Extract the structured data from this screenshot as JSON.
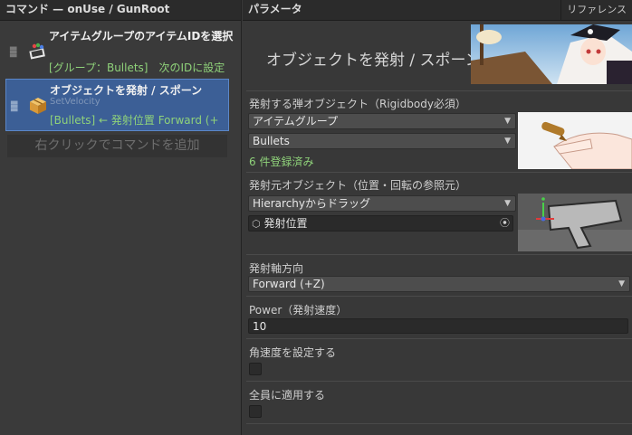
{
  "left": {
    "header": "コマンド — onUse / GunRoot",
    "commands": [
      {
        "title": "アイテムグループのアイテムIDを選択",
        "subtitle": "",
        "detail": "[グループ：Bullets]　次のIDに設定"
      },
      {
        "title": "オブジェクトを発射 / スポーン",
        "subtitle": "SetVelocity",
        "detail": "[Bullets] ← 発射位置  Forward (+"
      }
    ],
    "add_command": "右クリックでコマンドを追加"
  },
  "right": {
    "header": "パラメータ",
    "reference": "リファレンス",
    "title": "オブジェクトを発射 / スポーン",
    "projectile": {
      "label": "発射する弾オブジェクト（Rigidbody必須）",
      "source_select": "アイテムグループ",
      "group_select": "Bullets",
      "registered": "6 件登録済み"
    },
    "origin": {
      "label": "発射元オブジェクト（位置・回転の参照元）",
      "mode_select": "Hierarchyからドラッグ",
      "object_field": "発射位置"
    },
    "axis": {
      "label": "発射軸方向",
      "select": "Forward (+Z)"
    },
    "power": {
      "label": "Power（発射速度）",
      "value": "10"
    },
    "angular": {
      "label": "角速度を設定する"
    },
    "all_members": {
      "label": "全員に適用する"
    }
  }
}
